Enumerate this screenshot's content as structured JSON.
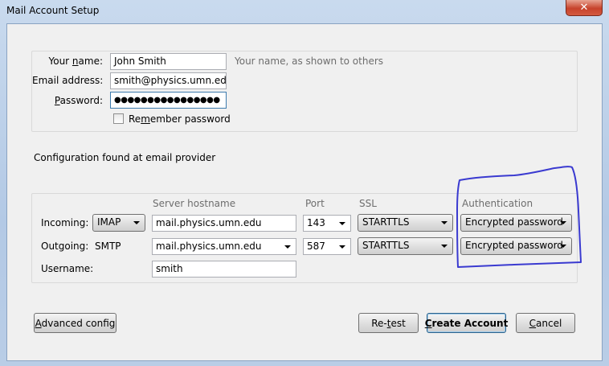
{
  "window": {
    "title": "Mail Account Setup",
    "close_glyph": "✕"
  },
  "identity": {
    "name_label": "Your name:",
    "name_value": "John Smith",
    "name_hint": "Your name, as shown to others",
    "email_label": "Email address:",
    "email_value": "smith@physics.umn.edu",
    "password_label": "Password:",
    "password_value": "●●●●●●●●●●●●●●●●",
    "remember_label": "Remember password",
    "remember_checked": false
  },
  "status_text": "Configuration found at email provider",
  "server": {
    "headers": {
      "hostname": "Server hostname",
      "port": "Port",
      "ssl": "SSL",
      "auth": "Authentication"
    },
    "incoming": {
      "label": "Incoming:",
      "protocol": "IMAP",
      "hostname": "mail.physics.umn.edu",
      "port": "143",
      "ssl": "STARTTLS",
      "auth": "Encrypted password"
    },
    "outgoing": {
      "label": "Outgoing:",
      "protocol": "SMTP",
      "hostname": "mail.physics.umn.edu",
      "port": "587",
      "ssl": "STARTTLS",
      "auth": "Encrypted password"
    },
    "username_label": "Username:",
    "username_value": "smith"
  },
  "buttons": {
    "advanced": "Advanced config",
    "retest": "Re-test",
    "create": "Create Account",
    "cancel": "Cancel"
  },
  "colors": {
    "annotation": "#3a3ad0",
    "title_bar": "#b9cde6",
    "dialog_bg": "#f0f0f0"
  },
  "annotation": {
    "shape": "hand-drawn box around Authentication column"
  }
}
